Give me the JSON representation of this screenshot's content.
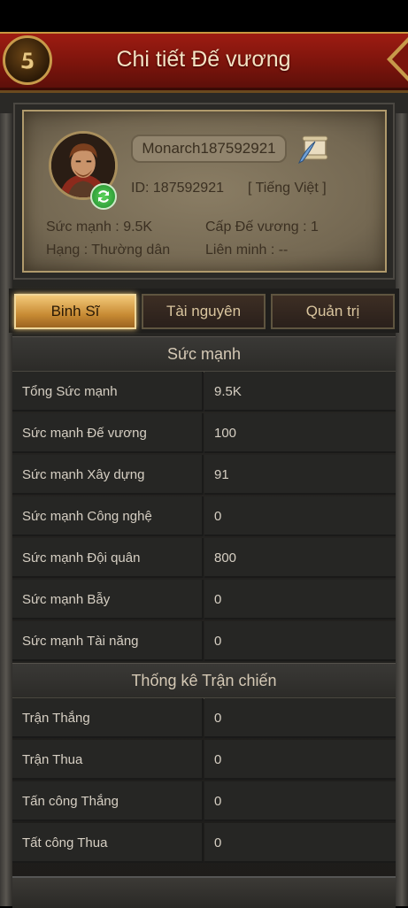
{
  "header": {
    "title": "Chi tiết Đế vương"
  },
  "profile": {
    "name": "Monarch187592921",
    "id_label": "ID:",
    "id_value": "187592921",
    "language": "[ Tiếng Việt ]",
    "power": "Sức mạnh : 9.5K",
    "monarch_level": "Cấp Đế vương : 1",
    "rank": "Hạng : Thường dân",
    "alliance": "Liên minh :   --"
  },
  "tabs": [
    {
      "label": "Binh Sĩ",
      "active": true
    },
    {
      "label": "Tài nguyên",
      "active": false
    },
    {
      "label": "Quản trị",
      "active": false
    }
  ],
  "sections": [
    {
      "title": "Sức mạnh",
      "rows": [
        {
          "label": "Tổng Sức mạnh",
          "value": "9.5K"
        },
        {
          "label": "Sức mạnh Đế vương",
          "value": "100"
        },
        {
          "label": "Sức mạnh Xây dựng",
          "value": "91"
        },
        {
          "label": "Sức mạnh Công nghệ",
          "value": "0"
        },
        {
          "label": "Sức mạnh Đội quân",
          "value": "800"
        },
        {
          "label": "Sức mạnh Bẫy",
          "value": "0"
        },
        {
          "label": "Sức mạnh Tài năng",
          "value": "0"
        }
      ]
    },
    {
      "title": "Thống kê Trận chiến",
      "rows": [
        {
          "label": "Trận Thắng",
          "value": "0"
        },
        {
          "label": "Trận Thua",
          "value": "0"
        },
        {
          "label": "Tấn công Thắng",
          "value": "0"
        },
        {
          "label": "Tất công Thua",
          "value": "0"
        }
      ]
    }
  ],
  "icons": {
    "back": "back-arrow-icon",
    "avatar": "hero-portrait",
    "sync": "sync-icon",
    "rename": "scroll-quill-icon"
  },
  "colors": {
    "header_red": "#9e1c12",
    "gold": "#c79a4a",
    "active_tab": "#f3c979"
  }
}
